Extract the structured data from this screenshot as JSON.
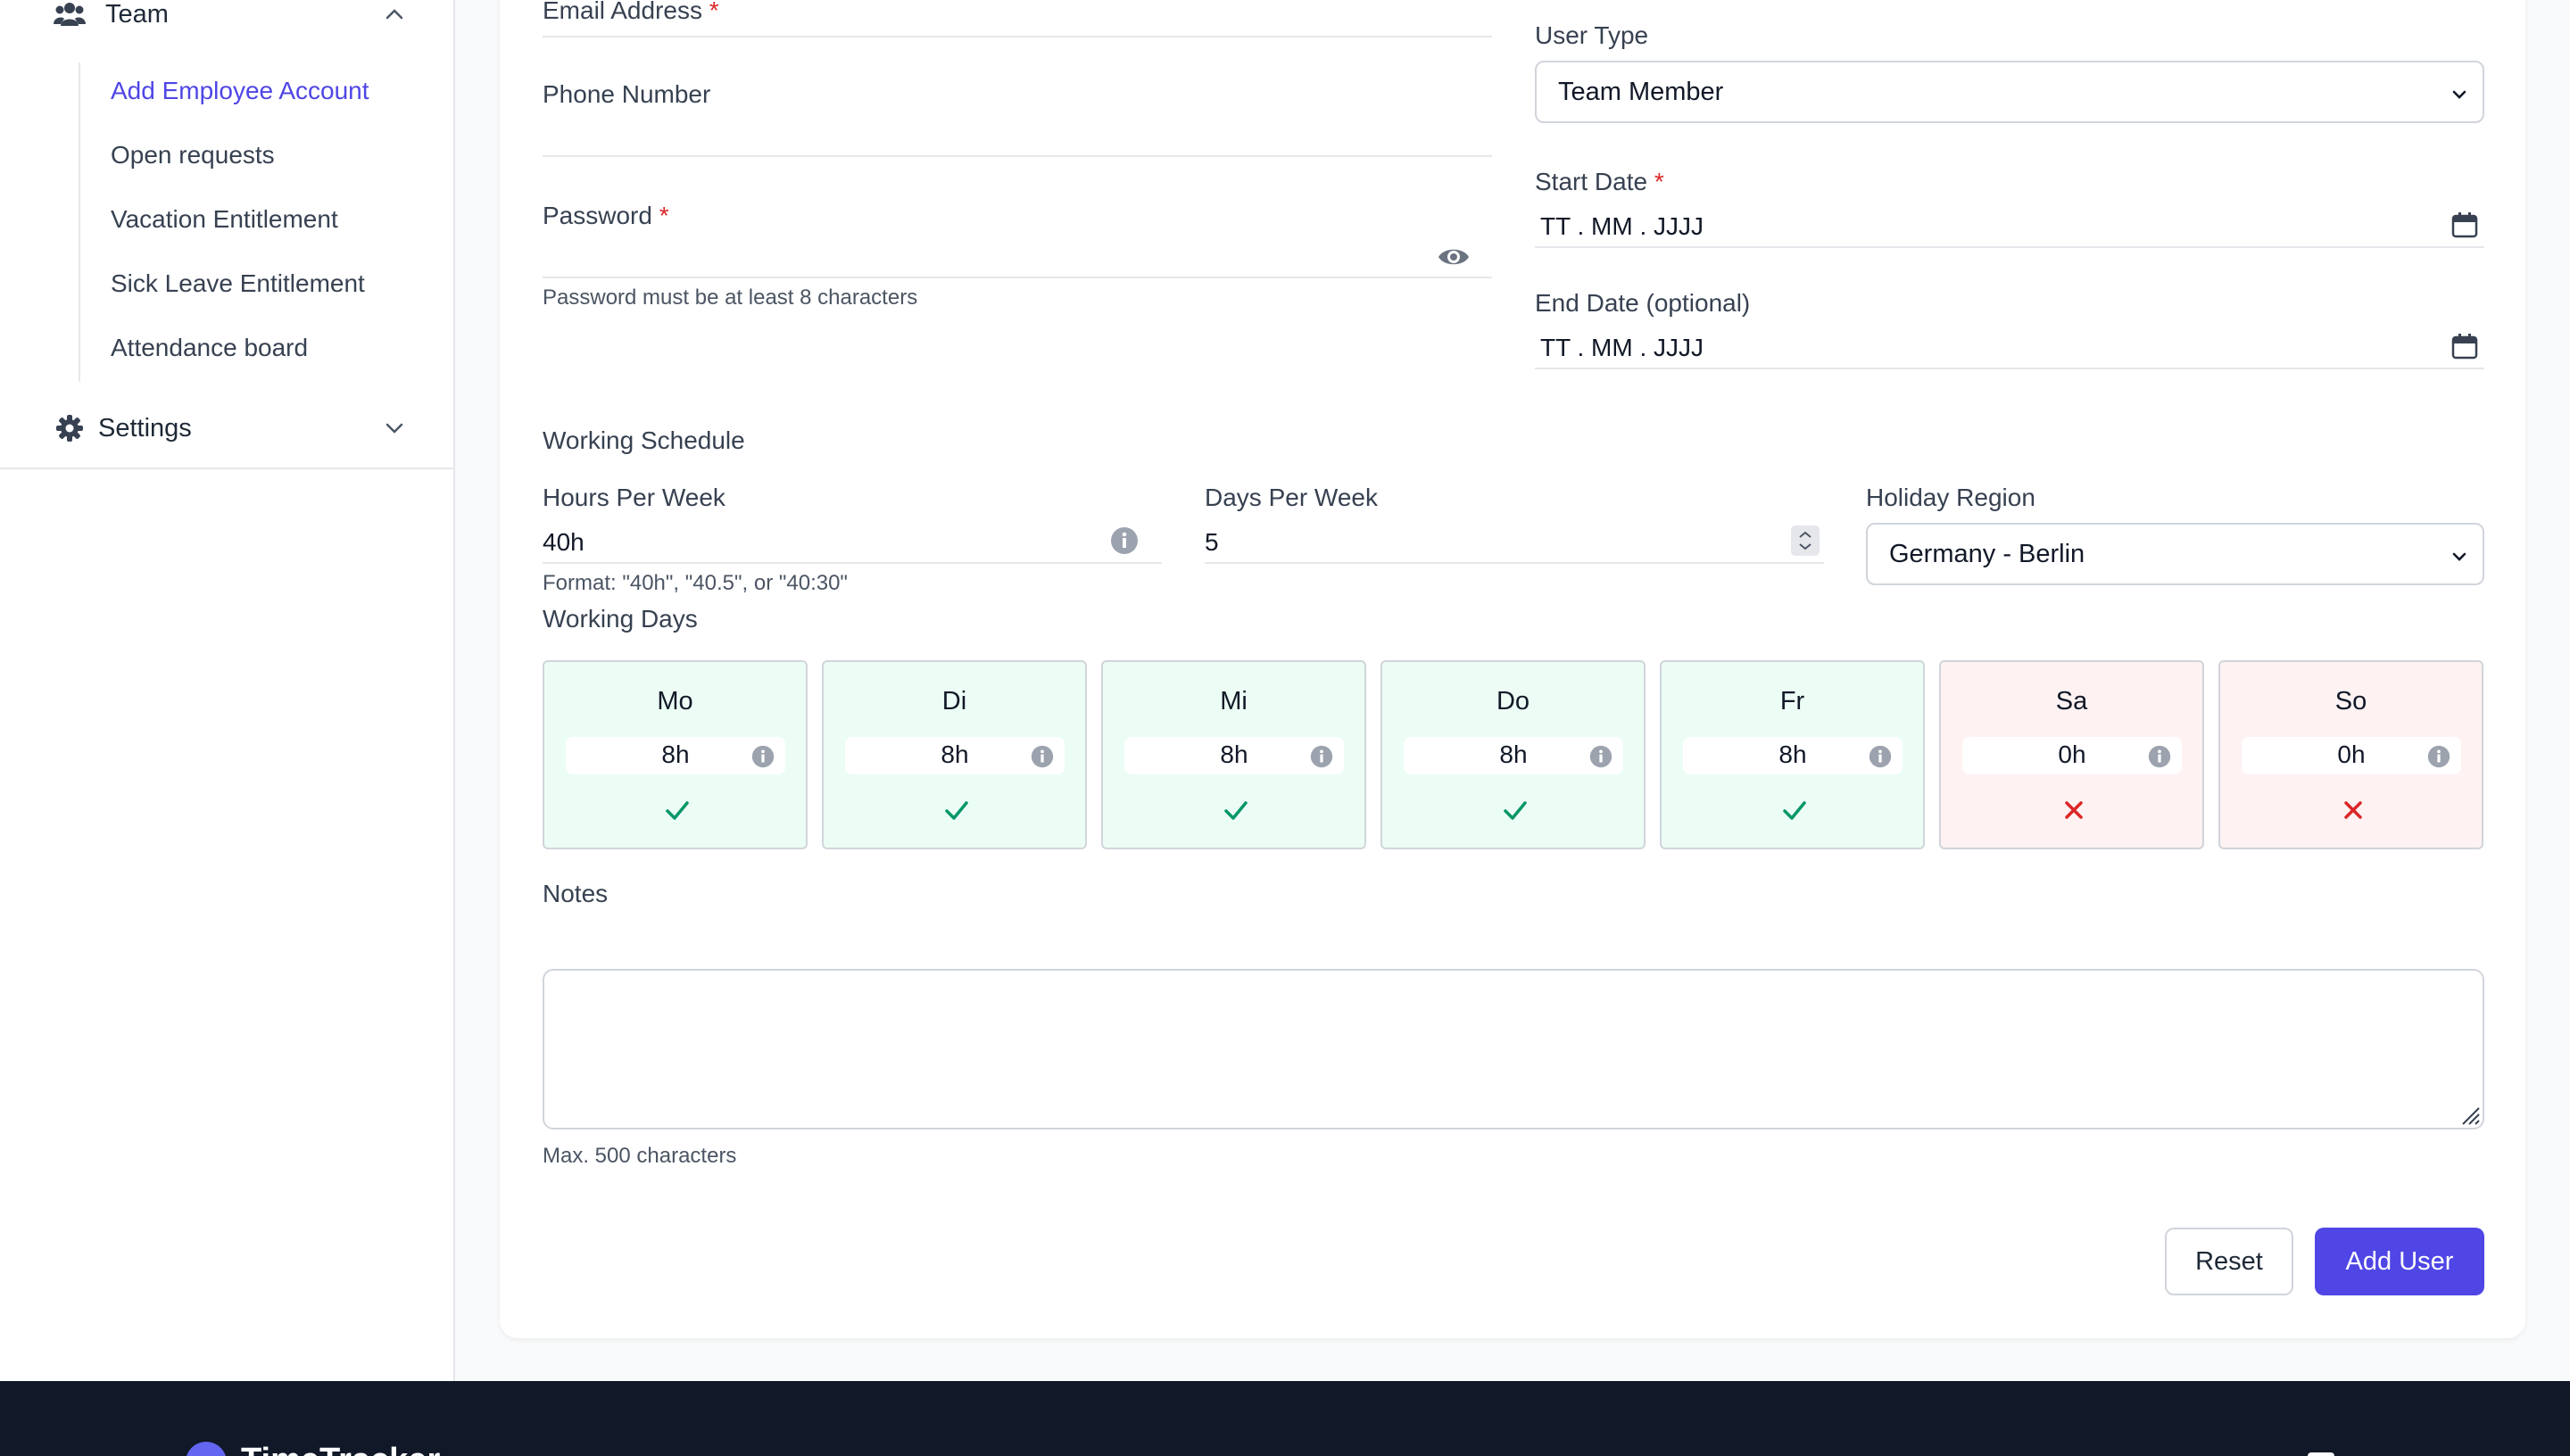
{
  "sidebar": {
    "team_label": "Team",
    "items": [
      {
        "label": "Add Employee Account"
      },
      {
        "label": "Open requests"
      },
      {
        "label": "Vacation Entitlement"
      },
      {
        "label": "Sick Leave Entitlement"
      },
      {
        "label": "Attendance board"
      }
    ],
    "settings_label": "Settings"
  },
  "form": {
    "email_label": "Email Address",
    "phone_label": "Phone Number",
    "password_label": "Password",
    "password_help": "Password must be at least 8 characters",
    "required_mark": "*",
    "user_type_label": "User Type",
    "user_type_value": "Team Member",
    "start_date_label": "Start Date",
    "start_date_placeholder": "TT . MM . JJJJ",
    "end_date_label": "End Date (optional)",
    "end_date_placeholder": "TT . MM . JJJJ",
    "working_schedule_label": "Working Schedule",
    "hours_per_week_label": "Hours Per Week",
    "hours_per_week_value": "40h",
    "hours_per_week_help": "Format: \"40h\", \"40.5\", or \"40:30\"",
    "days_per_week_label": "Days Per Week",
    "days_per_week_value": "5",
    "holiday_region_label": "Holiday Region",
    "holiday_region_value": "Germany - Berlin",
    "working_days_label": "Working Days",
    "days": [
      {
        "name": "Mo",
        "hours": "8h",
        "working": true
      },
      {
        "name": "Di",
        "hours": "8h",
        "working": true
      },
      {
        "name": "Mi",
        "hours": "8h",
        "working": true
      },
      {
        "name": "Do",
        "hours": "8h",
        "working": true
      },
      {
        "name": "Fr",
        "hours": "8h",
        "working": true
      },
      {
        "name": "Sa",
        "hours": "0h",
        "working": false
      },
      {
        "name": "So",
        "hours": "0h",
        "working": false
      }
    ],
    "notes_label": "Notes",
    "notes_help": "Max. 500 characters",
    "reset_label": "Reset",
    "add_user_label": "Add User"
  },
  "footer": {
    "brand": "TimeTracker"
  },
  "colors": {
    "accent": "#4f46e5",
    "working_bg": "#ecfdf5",
    "off_bg": "#fef2f2",
    "check": "#059669",
    "cross": "#dc2626"
  },
  "icons": {
    "team": "users-icon",
    "settings": "gear-icon",
    "password_toggle": "eye-icon",
    "date": "calendar-icon",
    "info": "info-icon",
    "working": "check-icon",
    "off": "x-icon"
  }
}
